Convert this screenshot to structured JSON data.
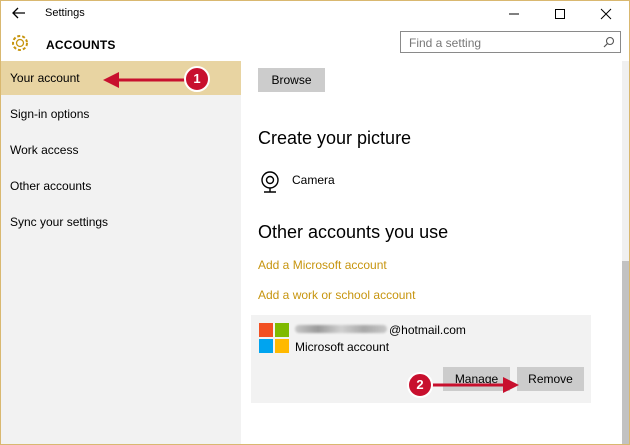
{
  "titlebar": {
    "title": "Settings"
  },
  "header": {
    "section": "ACCOUNTS",
    "search_placeholder": "Find a setting"
  },
  "sidebar": {
    "items": [
      {
        "label": "Your account",
        "active": true
      },
      {
        "label": "Sign-in options"
      },
      {
        "label": "Work access"
      },
      {
        "label": "Other accounts"
      },
      {
        "label": "Sync your settings"
      }
    ]
  },
  "main": {
    "browse_label": "Browse",
    "create_picture_heading": "Create your picture",
    "camera_label": "Camera",
    "other_accounts_heading": "Other accounts you use",
    "add_microsoft_link": "Add a Microsoft account",
    "add_work_link": "Add a work or school account",
    "account": {
      "email_domain": "@hotmail.com",
      "type": "Microsoft account",
      "manage_label": "Manage",
      "remove_label": "Remove"
    }
  },
  "annotations": {
    "marker1": "1",
    "marker2": "2"
  },
  "colors": {
    "accent": "#e8d4a2",
    "link": "#c7950f",
    "marker": "#c8102e",
    "ms_red": "#f25022",
    "ms_green": "#7fba00",
    "ms_blue": "#00a4ef",
    "ms_yellow": "#ffb900"
  }
}
